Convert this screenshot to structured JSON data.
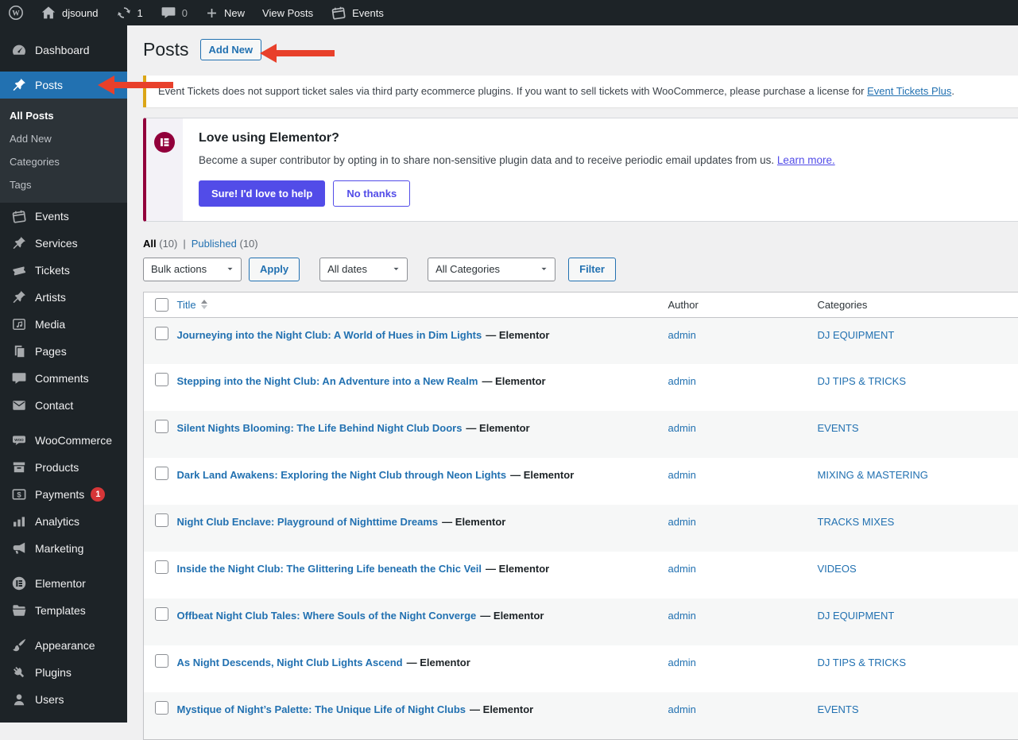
{
  "admin_bar": {
    "site_name": "djsound",
    "update_count": "1",
    "comment_count": "0",
    "new_label": "New",
    "view_posts_label": "View Posts",
    "events_label": "Events"
  },
  "sidebar": {
    "items": [
      {
        "id": "dashboard",
        "label": "Dashboard",
        "icon": "dashboard-icon"
      },
      {
        "id": "posts",
        "label": "Posts",
        "icon": "pushpin-icon",
        "active": true,
        "gap_before": true,
        "submenu": [
          {
            "id": "all-posts",
            "label": "All Posts",
            "current": true
          },
          {
            "id": "add-new",
            "label": "Add New"
          },
          {
            "id": "categories",
            "label": "Categories"
          },
          {
            "id": "tags",
            "label": "Tags"
          }
        ]
      },
      {
        "id": "events",
        "label": "Events",
        "icon": "events-calendar-icon"
      },
      {
        "id": "services",
        "label": "Services",
        "icon": "pushpin-icon"
      },
      {
        "id": "tickets",
        "label": "Tickets",
        "icon": "tickets-icon"
      },
      {
        "id": "artists",
        "label": "Artists",
        "icon": "pushpin-icon"
      },
      {
        "id": "media",
        "label": "Media",
        "icon": "media-icon"
      },
      {
        "id": "pages",
        "label": "Pages",
        "icon": "pages-icon"
      },
      {
        "id": "comments",
        "label": "Comments",
        "icon": "comments-icon"
      },
      {
        "id": "contact",
        "label": "Contact",
        "icon": "envelope-icon"
      },
      {
        "id": "woocommerce",
        "label": "WooCommerce",
        "icon": "woocommerce-icon",
        "gap_before": true
      },
      {
        "id": "products",
        "label": "Products",
        "icon": "products-icon"
      },
      {
        "id": "payments",
        "label": "Payments",
        "icon": "payments-icon",
        "badge": "1"
      },
      {
        "id": "analytics",
        "label": "Analytics",
        "icon": "analytics-icon"
      },
      {
        "id": "marketing",
        "label": "Marketing",
        "icon": "megaphone-icon"
      },
      {
        "id": "elementor",
        "label": "Elementor",
        "icon": "elementor-icon",
        "gap_before": true
      },
      {
        "id": "templates",
        "label": "Templates",
        "icon": "folder-icon"
      },
      {
        "id": "appearance",
        "label": "Appearance",
        "icon": "paintbrush-icon",
        "gap_before": true
      },
      {
        "id": "plugins",
        "label": "Plugins",
        "icon": "plug-icon"
      },
      {
        "id": "users",
        "label": "Users",
        "icon": "user-icon"
      }
    ]
  },
  "page": {
    "title": "Posts",
    "add_new_label": "Add New"
  },
  "ticket_notice": {
    "text": "Event Tickets does not support ticket sales via third party ecommerce plugins. If you want to sell tickets with WooCommerce, please purchase a license for ",
    "link_text": "Event Tickets Plus",
    "text_after": "."
  },
  "elementor_notice": {
    "heading": "Love using Elementor?",
    "body": "Become a super contributor by opting in to share non-sensitive plugin data and to receive periodic email updates from us. ",
    "link_text": "Learn more.",
    "primary_button": "Sure! I'd love to help",
    "secondary_button": "No thanks"
  },
  "filters": {
    "views": [
      {
        "label": "All",
        "count": "(10)",
        "current": true
      },
      {
        "label": "Published",
        "count": "(10)"
      }
    ],
    "views_separator": "|",
    "bulk_actions_label": "Bulk actions",
    "apply_label": "Apply",
    "dates_label": "All dates",
    "categories_label": "All Categories",
    "filter_label": "Filter"
  },
  "table": {
    "columns": {
      "title": "Title",
      "author": "Author",
      "categories": "Categories"
    },
    "rows": [
      {
        "title": "Journeying into the Night Club: A World of Hues in Dim Lights",
        "state": "— Elementor",
        "author": "admin",
        "category": "DJ EQUIPMENT"
      },
      {
        "title": "Stepping into the Night Club: An Adventure into a New Realm",
        "state": "— Elementor",
        "author": "admin",
        "category": "DJ TIPS & TRICKS"
      },
      {
        "title": "Silent Nights Blooming: The Life Behind Night Club Doors",
        "state": "— Elementor",
        "author": "admin",
        "category": "EVENTS"
      },
      {
        "title": "Dark Land Awakens: Exploring the Night Club through Neon Lights",
        "state": "— Elementor",
        "author": "admin",
        "category": "MIXING & MASTERING"
      },
      {
        "title": "Night Club Enclave: Playground of Nighttime Dreams",
        "state": "— Elementor",
        "author": "admin",
        "category": "TRACKS MIXES"
      },
      {
        "title": "Inside the Night Club: The Glittering Life beneath the Chic Veil",
        "state": "— Elementor",
        "author": "admin",
        "category": "VIDEOS"
      },
      {
        "title": "Offbeat Night Club Tales: Where Souls of the Night Converge",
        "state": "— Elementor",
        "author": "admin",
        "category": "DJ EQUIPMENT"
      },
      {
        "title": "As Night Descends, Night Club Lights Ascend",
        "state": "— Elementor",
        "author": "admin",
        "category": "DJ TIPS & TRICKS"
      },
      {
        "title": "Mystique of Night’s Palette: The Unique Life of Night Clubs",
        "state": "— Elementor",
        "author": "admin",
        "category": "EVENTS"
      }
    ]
  },
  "colors": {
    "accent_blue": "#2271b1",
    "admin_dark": "#1d2327",
    "submenu_dark": "#2c3338",
    "notice_yellow_border": "#dba617",
    "elementor_crimson": "#92003b",
    "elementor_purple": "#524ce8",
    "badge_red": "#d63638",
    "arrow_red": "#e8402b",
    "row_stripe": "#f6f7f7"
  }
}
